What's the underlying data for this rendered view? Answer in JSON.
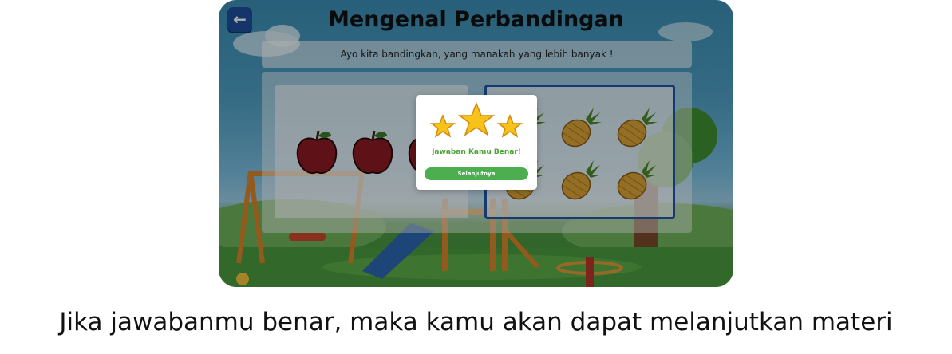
{
  "screen": {
    "title": "Mengenal Perbandingan",
    "instruction": "Ayo kita bandingkan, yang manakah yang lebih banyak !",
    "back_icon": "arrow-left-icon",
    "left_panel": {
      "item": "apple-icon",
      "count_visible": 3
    },
    "right_panel": {
      "item": "pineapple-icon",
      "count_visible": 6,
      "selected": true
    }
  },
  "modal": {
    "stars": 3,
    "message": "Jawaban Kamu Benar!",
    "button_label": "Selanjutnya"
  },
  "caption": "Jika jawabanmu benar, maka kamu akan dapat melanjutkan materi",
  "colors": {
    "title_text": "#111111",
    "back_button": "#1e4f9d",
    "selected_border": "#1f56a8",
    "success_text": "#4aa534",
    "success_button": "#4cae4f",
    "star": "#f7c21a"
  }
}
